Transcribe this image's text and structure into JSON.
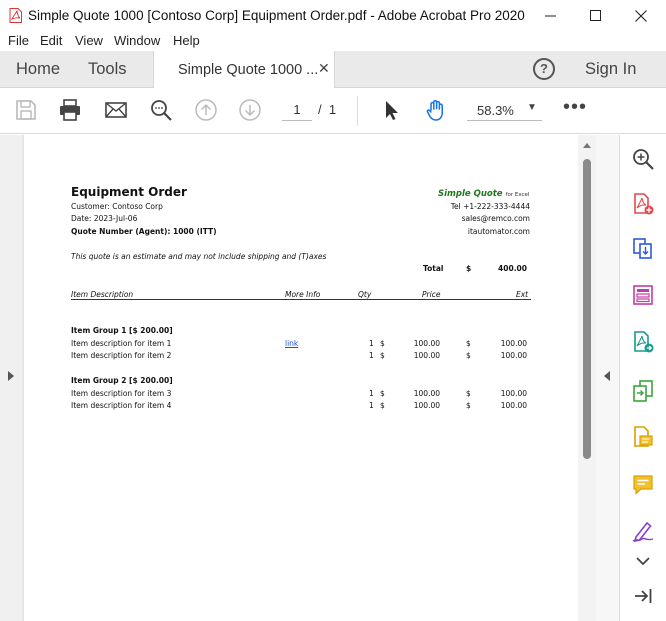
{
  "window": {
    "title": "Simple Quote 1000 [Contoso Corp] Equipment Order.pdf - Adobe Acrobat Pro 2020",
    "minimize": "—",
    "maximize": "☐",
    "close": "✕"
  },
  "menu": {
    "file": "File",
    "edit": "Edit",
    "view": "View",
    "window": "Window",
    "help": "Help"
  },
  "tabs": {
    "home": "Home",
    "tools": "Tools",
    "document": "Simple Quote 1000 ...",
    "close": "✕",
    "help": "?",
    "sign_in": "Sign In"
  },
  "toolbar": {
    "page_current": "1",
    "page_sep": "/",
    "page_total": "1",
    "zoom": "58.3%",
    "zoom_caret": "▼",
    "more": "•••"
  },
  "icons": {
    "save": "save-icon",
    "print": "print-icon",
    "email": "email-icon",
    "find": "find-icon",
    "prev": "previous-page-icon",
    "next": "next-page-icon",
    "select": "select-arrow-icon",
    "hand": "hand-icon",
    "tools": [
      "search-zoom-icon",
      "create-pdf-icon",
      "combine-files-icon",
      "organize-pages-icon",
      "export-pdf-icon",
      "edit-pdf-icon",
      "comment-icon",
      "fill-sign-icon",
      "more-tools-icon",
      "collapse-pane-icon"
    ]
  },
  "colors": {
    "accent": "#1473e6",
    "acrobat_red": "#e34850",
    "brand_green": "#1d7a1d",
    "link": "#1f4fd1"
  },
  "document": {
    "title": "Equipment Order",
    "customer": "Customer: Contoso Corp",
    "date": "Date: 2023-Jul-06",
    "quote_number": "Quote Number (Agent): 1000 (ITT)",
    "brand": "Simple Quote",
    "brand_sub": "for Excel",
    "phone": "Tel +1-222-333-4444",
    "email": "sales@remco.com",
    "website": "itautomator.com",
    "disclaimer": "This quote is an estimate and may not include shipping and (T)axes",
    "total_label": "Total",
    "total_currency": "$",
    "total_value": "400.00",
    "columns": {
      "description": "Item Description",
      "more_info": "More Info",
      "qty": "Qty",
      "price": "Price",
      "ext": "Ext"
    },
    "groups": [
      {
        "label": "Item Group 1 [$ 200.00]",
        "items": [
          {
            "description": "Item description for item 1",
            "more_info": "link",
            "qty": "1",
            "cur1": "$",
            "price": "100.00",
            "cur2": "$",
            "ext": "100.00"
          },
          {
            "description": "Item description for item 2",
            "more_info": "",
            "qty": "1",
            "cur1": "$",
            "price": "100.00",
            "cur2": "$",
            "ext": "100.00"
          }
        ]
      },
      {
        "label": "Item Group 2 [$ 200.00]",
        "items": [
          {
            "description": "Item description for item 3",
            "more_info": "",
            "qty": "1",
            "cur1": "$",
            "price": "100.00",
            "cur2": "$",
            "ext": "100.00"
          },
          {
            "description": "Item description for item 4",
            "more_info": "",
            "qty": "1",
            "cur1": "$",
            "price": "100.00",
            "cur2": "$",
            "ext": "100.00"
          }
        ]
      }
    ]
  }
}
